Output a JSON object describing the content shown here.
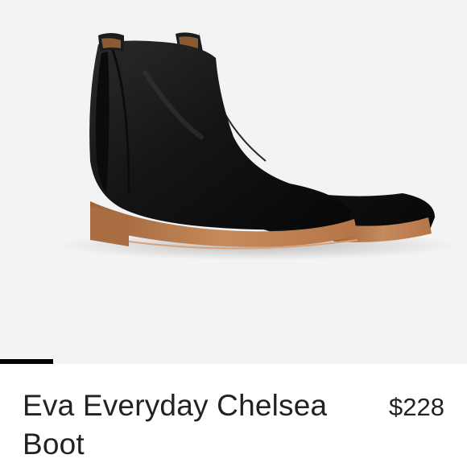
{
  "product": {
    "name": "Eva Everyday Chelsea Boot",
    "price": "$228",
    "image_alt": "Pair of black leather Chelsea ankle boots with tan wooden-look soles"
  },
  "carousel": {
    "active_index": 0
  },
  "colors": {
    "image_background": "#f3f3f3",
    "leather": "#151515",
    "sole": "#b97a4f",
    "indicator": "#000000",
    "text": "#222222"
  }
}
